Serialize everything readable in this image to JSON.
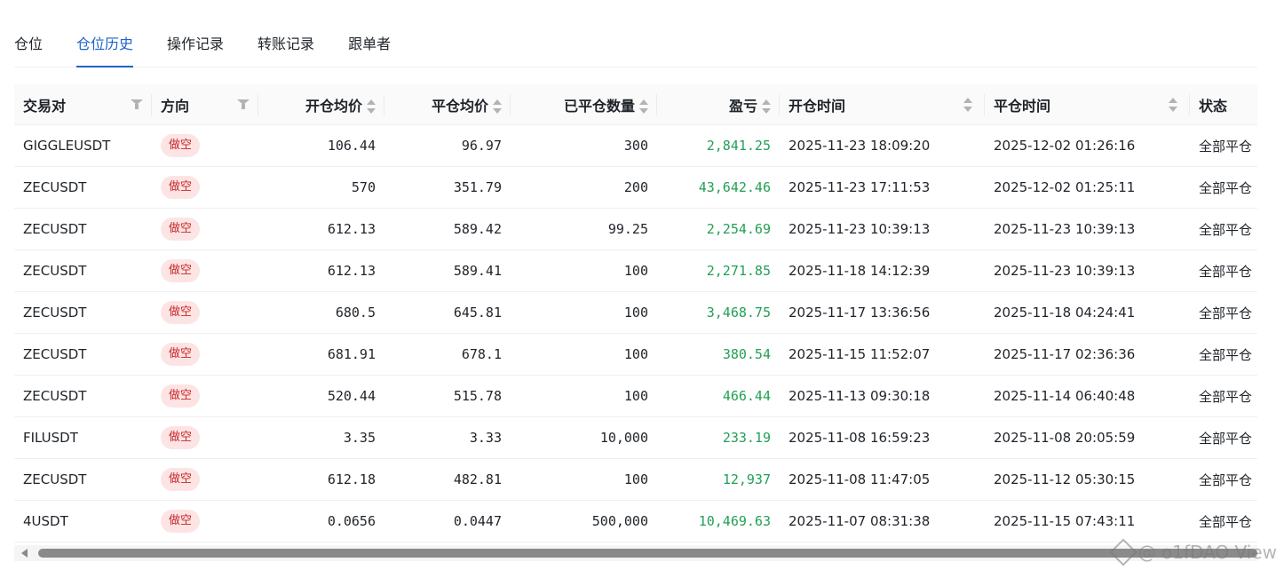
{
  "tabs": [
    {
      "label": "仓位",
      "active": false
    },
    {
      "label": "仓位历史",
      "active": true
    },
    {
      "label": "操作记录",
      "active": false
    },
    {
      "label": "转账记录",
      "active": false
    },
    {
      "label": "跟单者",
      "active": false
    }
  ],
  "table": {
    "headers": {
      "pair": "交易对",
      "direction": "方向",
      "open_avg": "开仓均价",
      "close_avg": "平仓均价",
      "closed_qty": "已平仓数量",
      "pnl": "盈亏",
      "open_time": "开仓时间",
      "close_time": "平仓时间",
      "status": "状态"
    },
    "rows": [
      {
        "pair": "GIGGLEUSDT",
        "direction": "做空",
        "open_avg": "106.44",
        "close_avg": "96.97",
        "closed_qty": "300",
        "pnl": "2,841.25",
        "open_time": "2025-11-23 18:09:20",
        "close_time": "2025-12-02 01:26:16",
        "status": "全部平仓"
      },
      {
        "pair": "ZECUSDT",
        "direction": "做空",
        "open_avg": "570",
        "close_avg": "351.79",
        "closed_qty": "200",
        "pnl": "43,642.46",
        "open_time": "2025-11-23 17:11:53",
        "close_time": "2025-12-02 01:25:11",
        "status": "全部平仓"
      },
      {
        "pair": "ZECUSDT",
        "direction": "做空",
        "open_avg": "612.13",
        "close_avg": "589.42",
        "closed_qty": "99.25",
        "pnl": "2,254.69",
        "open_time": "2025-11-23 10:39:13",
        "close_time": "2025-11-23 10:39:13",
        "status": "全部平仓"
      },
      {
        "pair": "ZECUSDT",
        "direction": "做空",
        "open_avg": "612.13",
        "close_avg": "589.41",
        "closed_qty": "100",
        "pnl": "2,271.85",
        "open_time": "2025-11-18 14:12:39",
        "close_time": "2025-11-23 10:39:13",
        "status": "全部平仓"
      },
      {
        "pair": "ZECUSDT",
        "direction": "做空",
        "open_avg": "680.5",
        "close_avg": "645.81",
        "closed_qty": "100",
        "pnl": "3,468.75",
        "open_time": "2025-11-17 13:36:56",
        "close_time": "2025-11-18 04:24:41",
        "status": "全部平仓"
      },
      {
        "pair": "ZECUSDT",
        "direction": "做空",
        "open_avg": "681.91",
        "close_avg": "678.1",
        "closed_qty": "100",
        "pnl": "380.54",
        "open_time": "2025-11-15 11:52:07",
        "close_time": "2025-11-17 02:36:36",
        "status": "全部平仓"
      },
      {
        "pair": "ZECUSDT",
        "direction": "做空",
        "open_avg": "520.44",
        "close_avg": "515.78",
        "closed_qty": "100",
        "pnl": "466.44",
        "open_time": "2025-11-13 09:30:18",
        "close_time": "2025-11-14 06:40:48",
        "status": "全部平仓"
      },
      {
        "pair": "FILUSDT",
        "direction": "做空",
        "open_avg": "3.35",
        "close_avg": "3.33",
        "closed_qty": "10,000",
        "pnl": "233.19",
        "open_time": "2025-11-08 16:59:23",
        "close_time": "2025-11-08 20:05:59",
        "status": "全部平仓"
      },
      {
        "pair": "ZECUSDT",
        "direction": "做空",
        "open_avg": "612.18",
        "close_avg": "482.81",
        "closed_qty": "100",
        "pnl": "12,937",
        "open_time": "2025-11-08 11:47:05",
        "close_time": "2025-11-12 05:30:15",
        "status": "全部平仓"
      },
      {
        "pair": "4USDT",
        "direction": "做空",
        "open_avg": "0.0656",
        "close_avg": "0.0447",
        "closed_qty": "500,000",
        "pnl": "10,469.63",
        "open_time": "2025-11-07 08:31:38",
        "close_time": "2025-11-15 07:43:11",
        "status": "全部平仓"
      }
    ]
  },
  "watermark": "@ o1fDAO View",
  "colors": {
    "accent": "#1d63c8",
    "profit": "#22a055",
    "short_badge_bg": "#fde4e4",
    "short_badge_text": "#c62828"
  },
  "icons": {
    "filter": "filter-icon",
    "sort": "sort-icon",
    "scroll_left": "scroll-left-arrow-icon"
  }
}
